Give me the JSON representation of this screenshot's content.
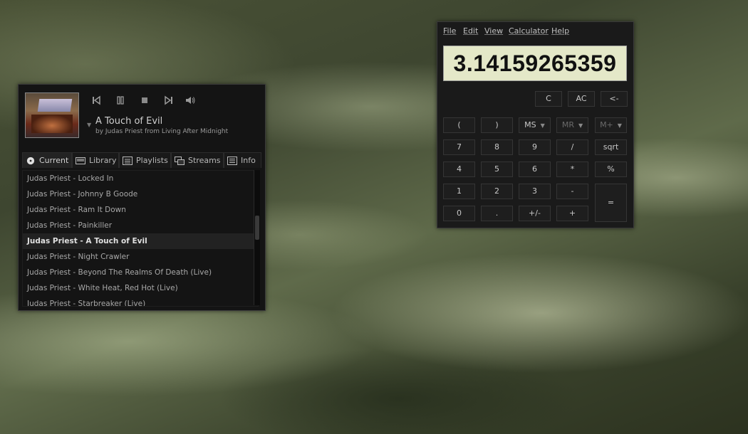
{
  "player": {
    "controls": [
      "previous-icon",
      "pause-icon",
      "stop-icon",
      "next-icon",
      "volume-icon"
    ],
    "track_title": "A Touch of Evil",
    "track_sub": "by Judas Priest from Living After Midnight",
    "tabs": [
      {
        "label": "Current",
        "icon": "disc-icon"
      },
      {
        "label": "Library",
        "icon": "library-icon"
      },
      {
        "label": "Playlists",
        "icon": "playlist-icon"
      },
      {
        "label": "Streams",
        "icon": "streams-icon"
      },
      {
        "label": "Info",
        "icon": "info-icon"
      }
    ],
    "playlist": [
      "Judas Priest - Locked In",
      "Judas Priest - Johnny B Goode",
      "Judas Priest - Ram It Down",
      "Judas Priest - Painkiller",
      "Judas Priest - A Touch of Evil",
      "Judas Priest - Night Crawler",
      "Judas Priest - Beyond The Realms Of Death (Live)",
      "Judas Priest - White Heat, Red Hot (Live)",
      "Judas Priest - Starbreaker (Live)"
    ],
    "now_playing_index": 4
  },
  "calculator": {
    "menu": [
      "File",
      "Edit",
      "View",
      "Calculator",
      "Help"
    ],
    "display": "3.14159265359",
    "buttons": {
      "clear": "C",
      "all_clear": "AC",
      "backspace": "<-",
      "lparen": "(",
      "rparen": ")",
      "ms": "MS",
      "mr": "MR",
      "mplus": "M+",
      "seven": "7",
      "eight": "8",
      "nine": "9",
      "divide": "/",
      "sqrt": "sqrt",
      "four": "4",
      "five": "5",
      "six": "6",
      "multiply": "*",
      "percent": "%",
      "one": "1",
      "two": "2",
      "three": "3",
      "minus": "-",
      "equals": "=",
      "zero": "0",
      "point": ".",
      "negate": "+/-",
      "plus": "+"
    }
  },
  "colors": {
    "window_bg": "#141414",
    "display_bg": "#e4e8c8",
    "text": "#c8c8c8"
  }
}
